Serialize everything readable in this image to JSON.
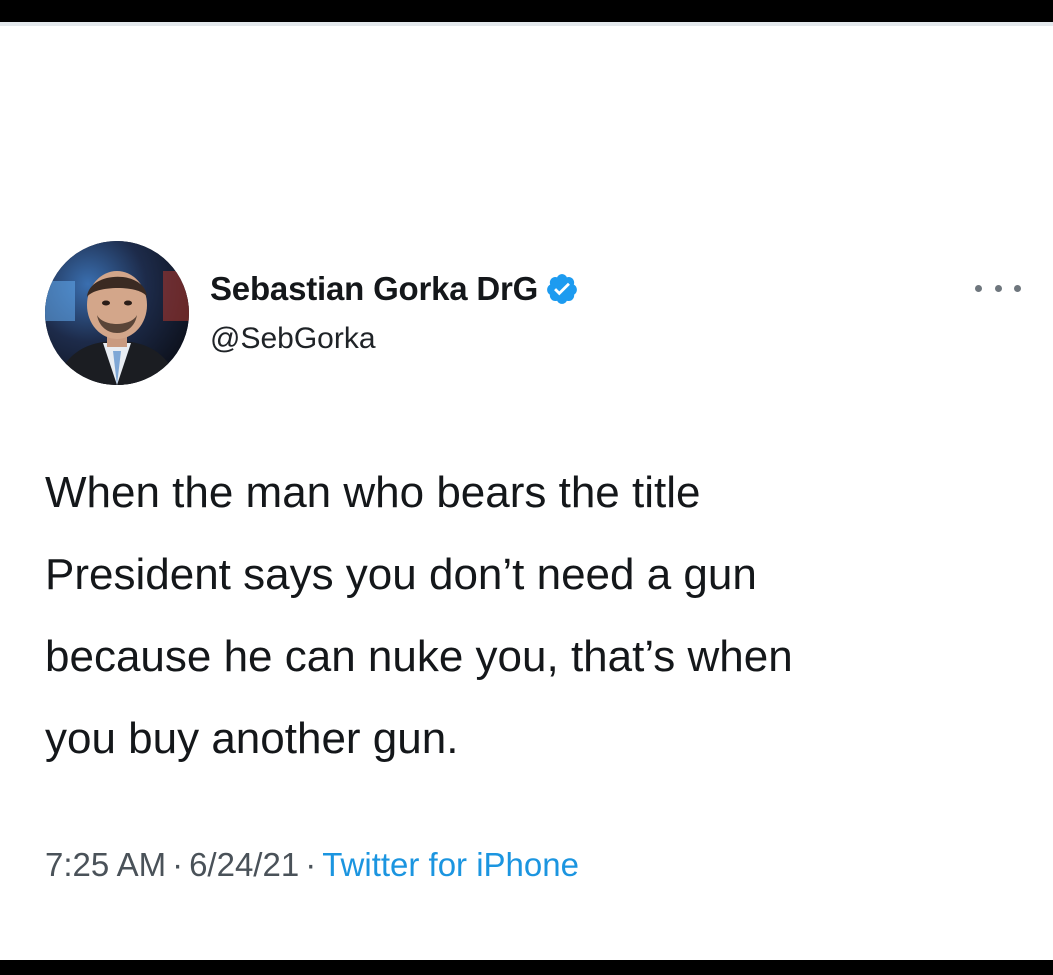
{
  "tweet": {
    "author": {
      "display_name": "Sebastian Gorka DrG",
      "handle": "@SebGorka",
      "verified": true
    },
    "text_lines": [
      "When the man who bears the title",
      "President says you don’t need a gun",
      "because he can nuke you, that’s when",
      "you buy another gun."
    ],
    "time": "7:25 AM",
    "date": "6/24/21",
    "separator": "·",
    "source": "Twitter for iPhone"
  },
  "icons": {
    "verified": "verified-badge-icon",
    "more": "more-options-icon"
  },
  "colors": {
    "link": "#1b95e0",
    "verified": "#1d9bf0",
    "text": "#14171a"
  }
}
